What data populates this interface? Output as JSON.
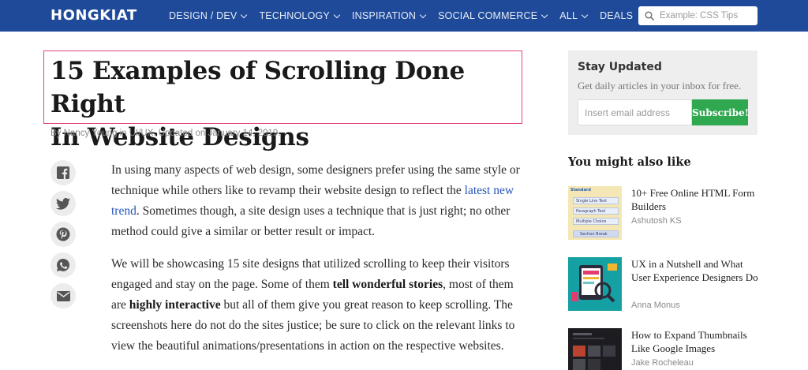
{
  "header": {
    "logo": "HONGKIAT",
    "nav": [
      {
        "label": "DESIGN / DEV",
        "dropdown": true
      },
      {
        "label": "TECHNOLOGY",
        "dropdown": true
      },
      {
        "label": "INSPIRATION",
        "dropdown": true
      },
      {
        "label": "SOCIAL COMMERCE",
        "dropdown": true
      },
      {
        "label": "ALL",
        "dropdown": true
      },
      {
        "label": "DEALS",
        "dropdown": false
      }
    ],
    "search_placeholder": "Example: CSS Tips"
  },
  "article": {
    "title_line1": "15 Examples of Scrolling Done Right",
    "title_line2": "In Website Designs",
    "byline": "By Nancy Young in UI/UX. Updated on January 14, 2019.",
    "p1_before": "In using many aspects of web design, some designers prefer using the same style or technique while others like to revamp their website design to reflect the ",
    "p1_link": "latest new trend",
    "p1_after": ". Sometimes though, a site design uses a technique that is just right; no other method could give a similar or better result or impact.",
    "p2_a": "We will be showcasing 15 site designs that utilized scrolling to keep their visitors engaged and stay on the page. Some of them ",
    "p2_b1": "tell wonderful stories",
    "p2_c": ", most of them are ",
    "p2_b2": "highly interactive",
    "p2_d": " but all of them give you great reason to keep scrolling. The screenshots here do not do the sites justice; be sure to click on the relevant links to view the beautiful animations/presentations in action on the respective websites."
  },
  "share_icons": [
    "facebook-icon",
    "twitter-icon",
    "pinterest-icon",
    "whatsapp-icon",
    "email-icon"
  ],
  "sidebar": {
    "newsletter": {
      "title": "Stay Updated",
      "subtitle": "Get daily articles in your inbox for free.",
      "email_placeholder": "Insert email address",
      "button": "Subscribe!"
    },
    "related_title": "You might also like",
    "related": [
      {
        "title": "10+ Free Online HTML Form Builders",
        "author": "Ashutosh KS",
        "thumb_text": [
          "Standard",
          "Single Line Text",
          "Paragraph Text",
          "Multiple Choice",
          "Section Break"
        ]
      },
      {
        "title": "UX in a Nutshell and What User Experience Designers Do",
        "author": "Anna Monus"
      },
      {
        "title": "How to Expand Thumbnails Like Google Images",
        "author": "Jake Rocheleau"
      }
    ]
  },
  "colors": {
    "header_bg": "#1f4a99",
    "title_outline": "#e0457b",
    "link": "#2455b8",
    "subscribe": "#2fa84f"
  }
}
